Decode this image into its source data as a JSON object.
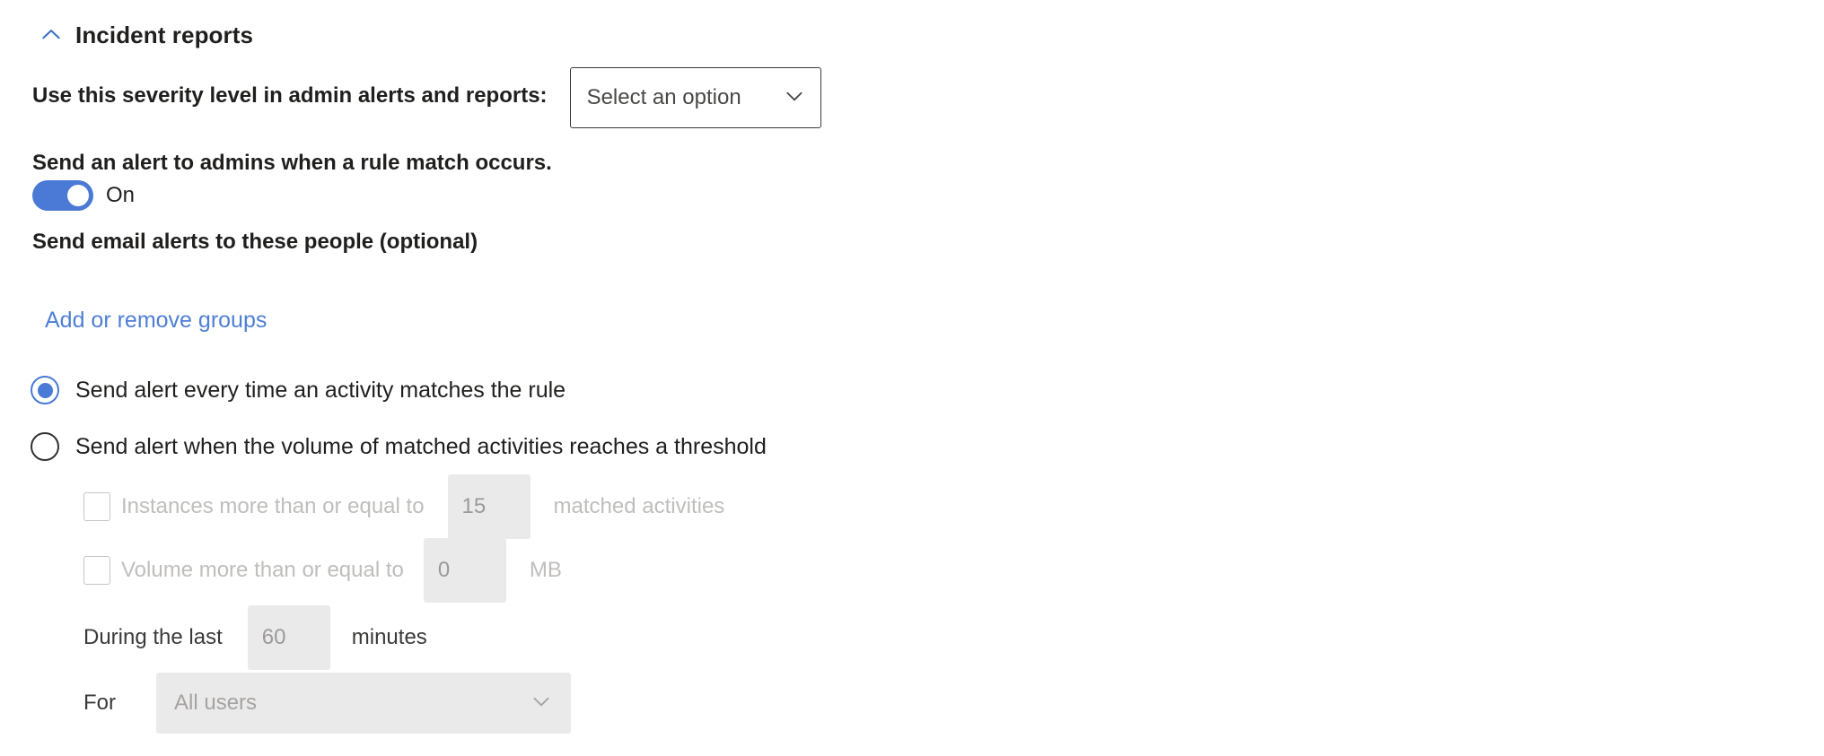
{
  "section": {
    "title": "Incident reports",
    "collapse_icon": "chevron-up-icon",
    "expanded": true
  },
  "severity": {
    "label": "Use this severity level in admin alerts and reports:",
    "dropdown_value": "Select an option",
    "dropdown_icon": "chevron-down-icon"
  },
  "admin_alert": {
    "label": "Send an alert to admins when a rule match occurs.",
    "toggle_state": "On",
    "toggle_on": true
  },
  "email_alerts": {
    "label": "Send email alerts to these people (optional)",
    "link_text": "Add or remove groups"
  },
  "alert_frequency": {
    "options": [
      {
        "label": "Send alert every time an activity matches the rule",
        "selected": true
      },
      {
        "label": "Send alert when the volume of matched activities reaches a threshold",
        "selected": false
      }
    ]
  },
  "threshold": {
    "instances": {
      "checkbox_checked": false,
      "label": "Instances more than or equal to",
      "value": "",
      "placeholder": "15",
      "unit": "matched activities"
    },
    "volume": {
      "checkbox_checked": false,
      "label": "Volume more than or equal to",
      "value": "",
      "placeholder": "0",
      "unit": "MB"
    },
    "duration": {
      "label": "During the last",
      "value": "",
      "placeholder": "60",
      "unit": "minutes"
    },
    "scope": {
      "label": "For",
      "selected_value": "All users",
      "dropdown_icon": "chevron-down-icon"
    }
  },
  "colors": {
    "accent_blue": "#4a7ad5",
    "link_blue": "#4f7fd4",
    "text_primary": "#201f1e",
    "text_disabled": "#c0bebc",
    "field_bg": "#ebeaea",
    "border_dark": "#3b3a39"
  }
}
